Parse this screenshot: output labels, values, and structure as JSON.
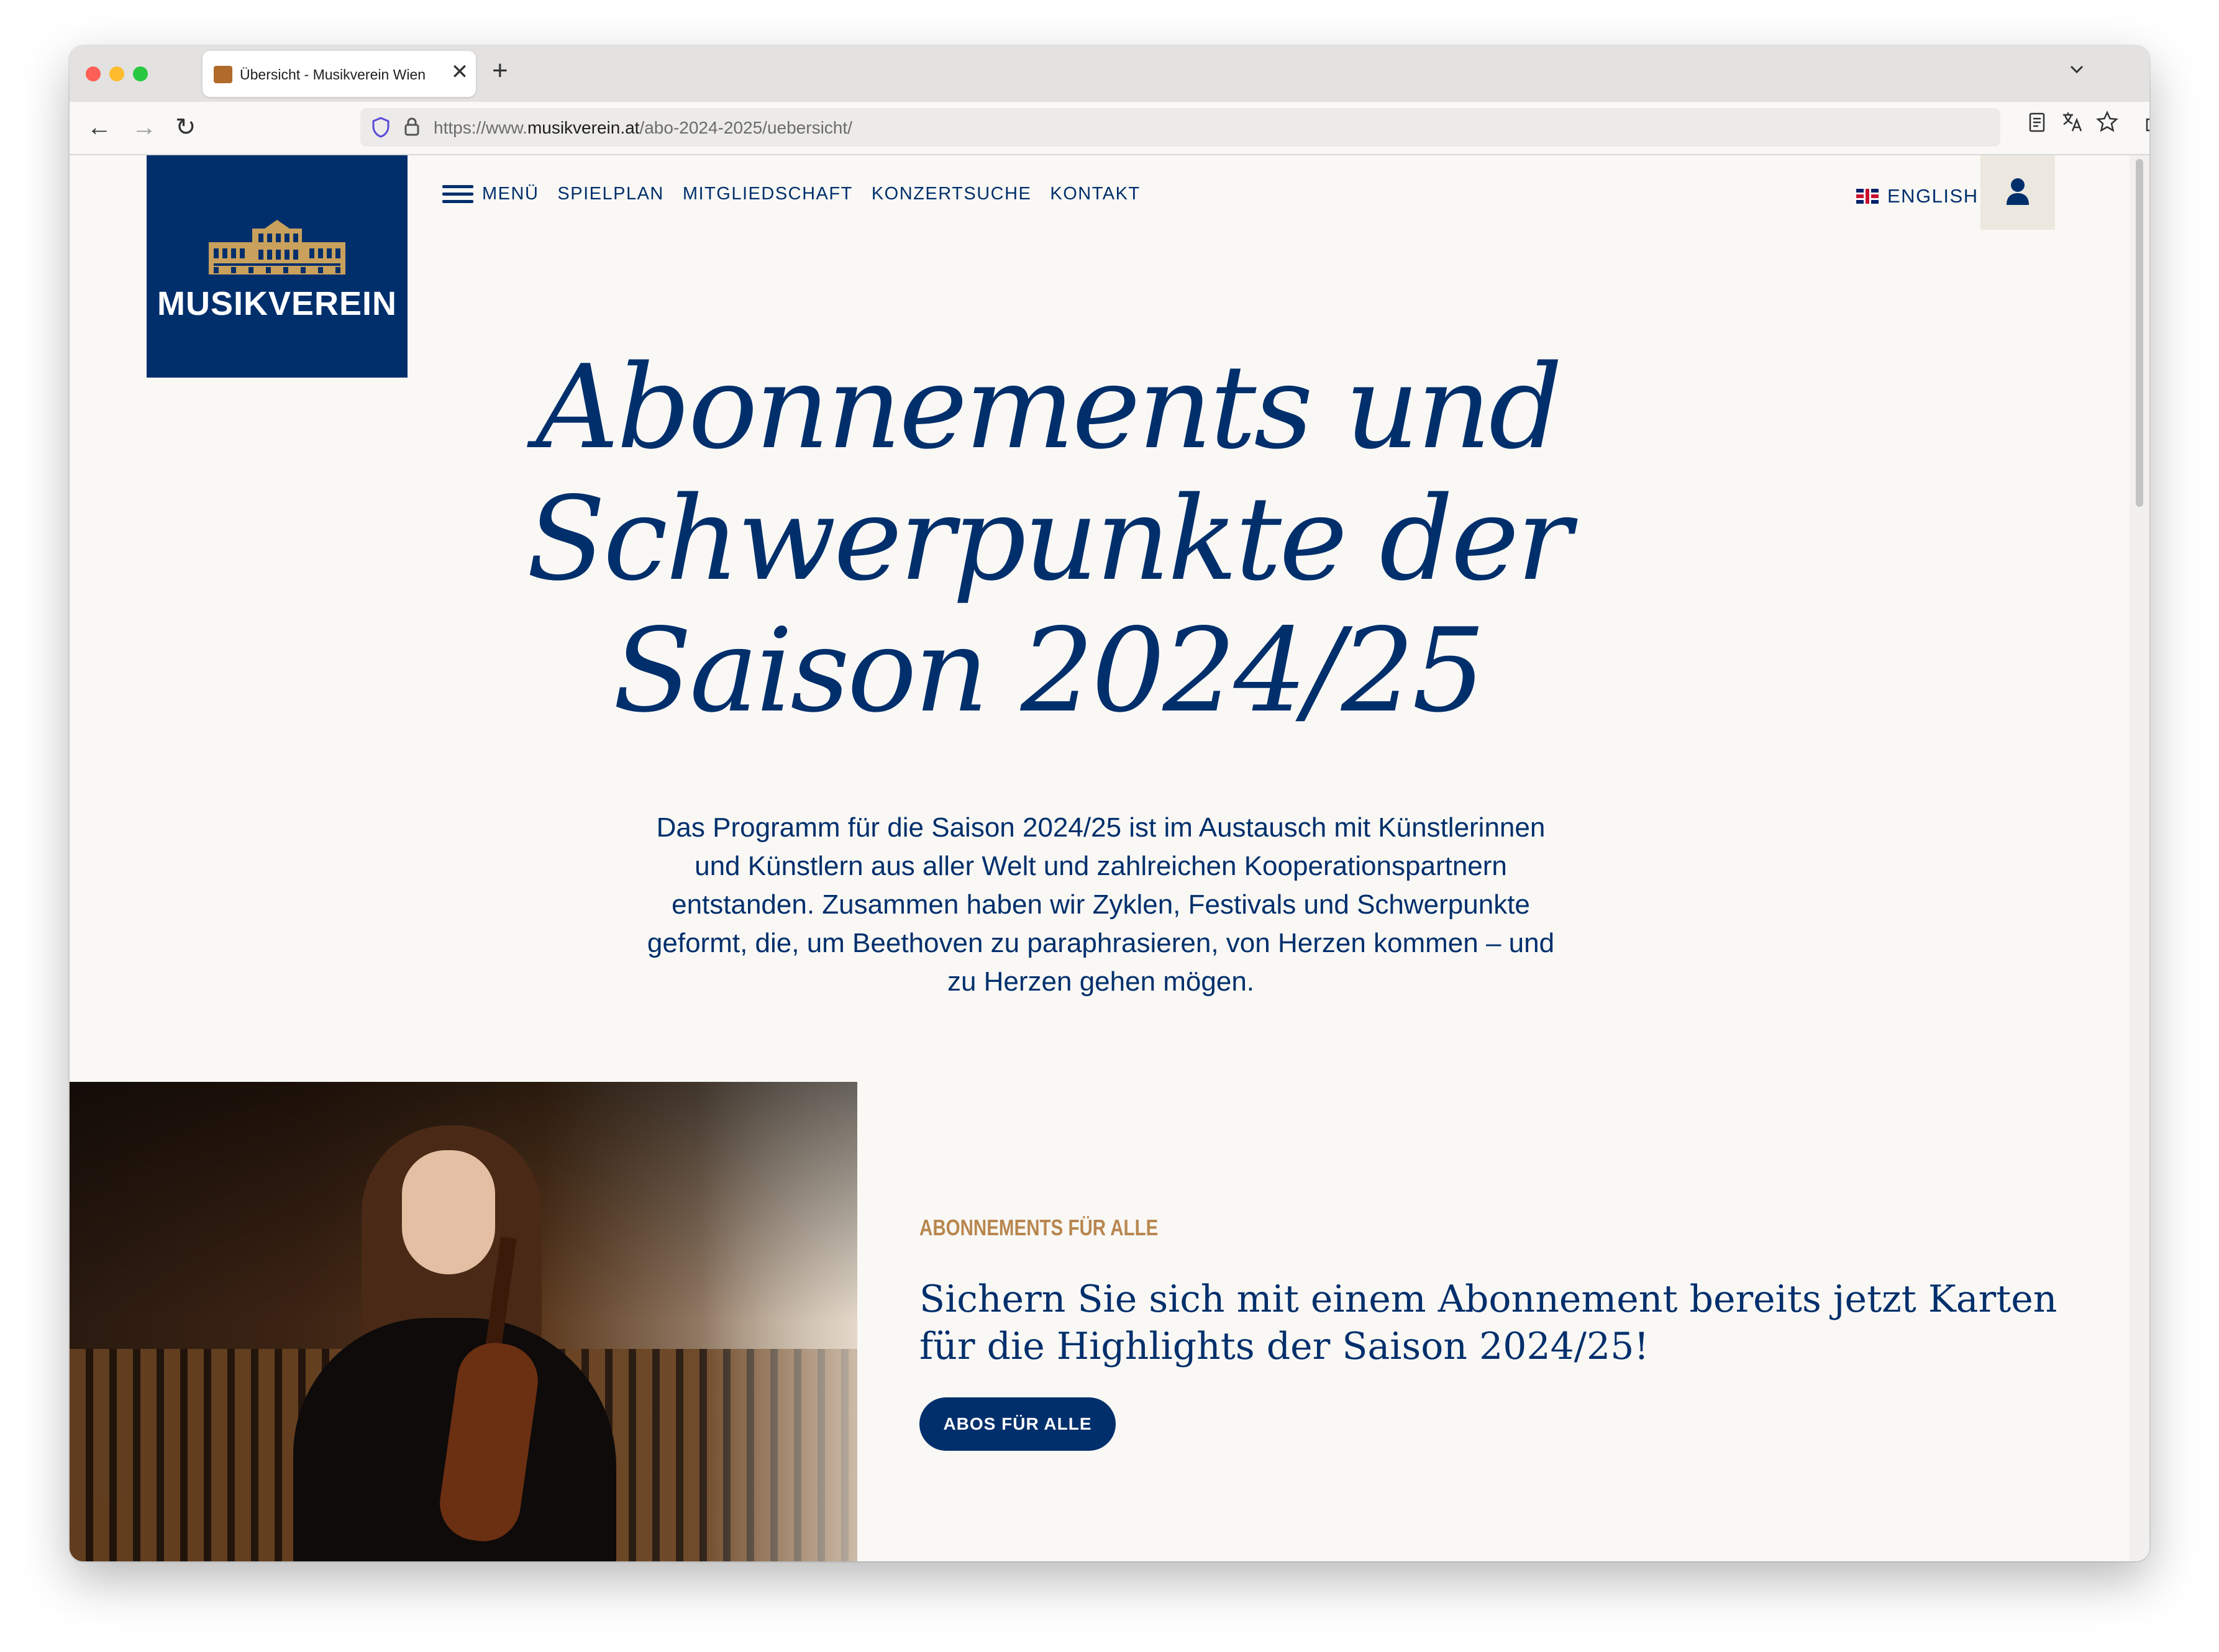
{
  "browser": {
    "tab_title": "Übersicht - Musikverein Wien",
    "tab_close": "✕",
    "new_tab": "+",
    "tab_list": "⌄",
    "url_prefix": "https://www.",
    "url_domain": "musikverein.at",
    "url_path": "/abo-2024-2025/uebersicht/",
    "back": "←",
    "forward": "→",
    "reload": "↻"
  },
  "site": {
    "logo_text": "MUSIKVEREIN",
    "nav": {
      "menu": "MENÜ",
      "items": [
        "SPIELPLAN",
        "MITGLIEDSCHAFT",
        "KONZERTSUCHE",
        "KONTAKT"
      ]
    },
    "language": "ENGLISH"
  },
  "hero": {
    "title_lines": [
      "Abonnements und",
      "Schwerpunkte der",
      "Saison 2024/25"
    ],
    "text": "Das Programm für die Saison 2024/25 ist im Austausch mit Künstlerinnen und Künstlern aus aller Welt und zahlreichen Kooperationspartnern entstanden. Zusammen haben wir Zyklen, Festivals und Schwerpunkte geformt, die, um Beethoven zu paraphrasieren, von Herzen kommen – und zu Herzen gehen mögen."
  },
  "teaser": {
    "eyebrow": "ABONNEMENTS FÜR ALLE",
    "headline": "Sichern Sie sich mit einem Abonnement bereits jetzt Karten für die Highlights der Saison 2024/25!",
    "button": "ABOS FÜR ALLE"
  },
  "colors": {
    "brand_blue": "#002f6c",
    "gold_accent": "#b8874f",
    "background": "#f9f8f5"
  }
}
